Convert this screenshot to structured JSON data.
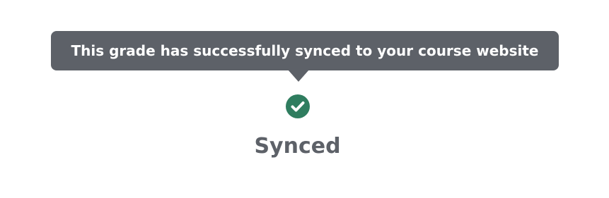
{
  "tooltip": {
    "text": "This grade has successfully synced to your course website"
  },
  "status": {
    "icon": "check-circle-icon",
    "label": "Synced",
    "icon_color": "#2f7d5f"
  },
  "colors": {
    "tooltip_background": "#5d6168",
    "label_text": "#5d6168"
  }
}
